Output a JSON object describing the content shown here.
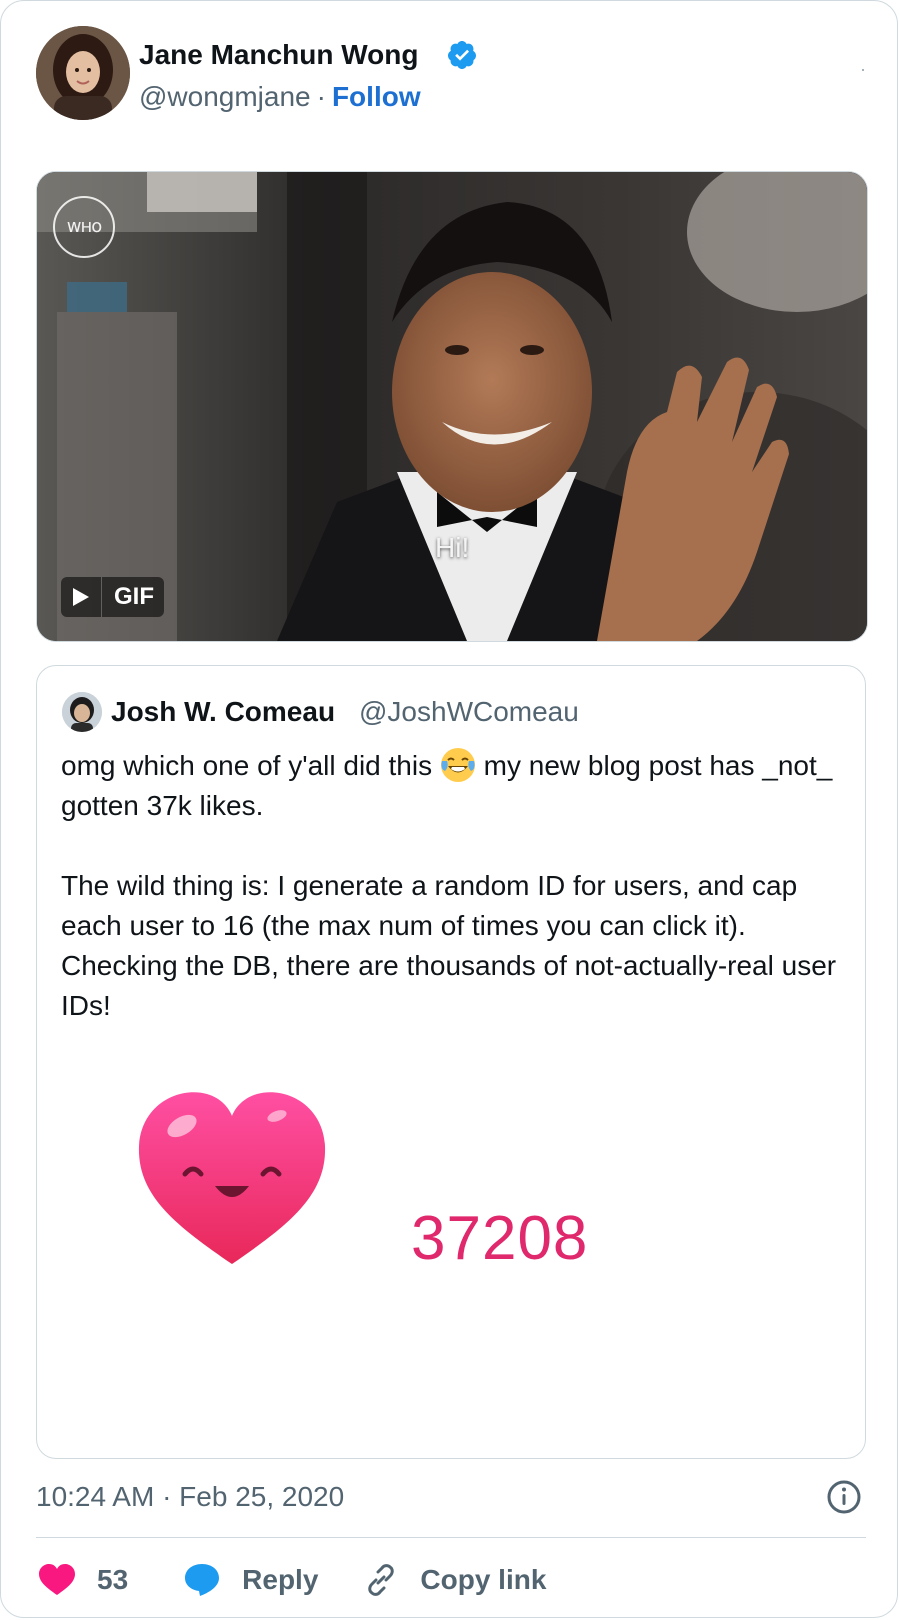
{
  "author": {
    "name": "Jane Manchun Wong",
    "handle": "@wongmjane",
    "separator": "·",
    "follow_label": "Follow",
    "verified": true
  },
  "media": {
    "type_label": "GIF",
    "watermark": "wнo",
    "caption": "Hi!"
  },
  "quoted_tweet": {
    "name": "Josh W. Comeau",
    "handle": "@JoshWComeau",
    "text_line1_before_emoji": "omg which one of y'all did this",
    "emoji": "face-with-tears-of-joy",
    "text_line1_after_emoji": "my new blog post has _not_ gotten 37k likes.",
    "text_paragraph2": "The wild thing is: I generate a random ID for users, and cap each user to 16 (the max num of times you can click it). Checking the DB, there are thousands of not-actually-real user IDs!",
    "like_counter_value": "37208"
  },
  "footer": {
    "timestamp": "10:24 AM · Feb 25, 2020",
    "like_count": "53",
    "reply_label": "Reply",
    "copy_link_label": "Copy link"
  },
  "colors": {
    "accent": "#1d6fd1",
    "verified": "#1d9bf0",
    "heart": "#f91880",
    "counter": "#e0286c",
    "muted_text": "#536471",
    "border": "#cfd9de"
  }
}
